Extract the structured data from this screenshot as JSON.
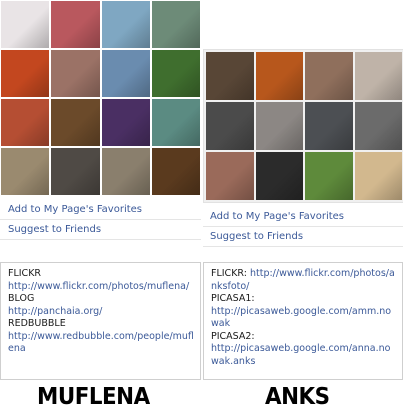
{
  "left": {
    "thumbnails": [
      {
        "name": "cake-photo",
        "color": "#e9e4e6"
      },
      {
        "name": "girl-pink-dress-photo",
        "color": "#b9585e"
      },
      {
        "name": "boy-striped-shirt-photo",
        "color": "#7fa7c2"
      },
      {
        "name": "dragonfly-photo",
        "color": "#6d8b78"
      },
      {
        "name": "red-girl-portrait-photo",
        "color": "#c3471f"
      },
      {
        "name": "woman-face-photo",
        "color": "#9b7266"
      },
      {
        "name": "car-sunset-photo",
        "color": "#6a8caf"
      },
      {
        "name": "tulip-photo",
        "color": "#3f6e2e"
      },
      {
        "name": "boy-portrait-photo",
        "color": "#b54e33"
      },
      {
        "name": "cardboard-robot-photo",
        "color": "#6b4a2a"
      },
      {
        "name": "guitarist-photo",
        "color": "#4a2f63"
      },
      {
        "name": "crowd-park-photo",
        "color": "#5b8b82"
      },
      {
        "name": "girl-lying-photo",
        "color": "#9a8a6f"
      },
      {
        "name": "cat-sleeping-photo",
        "color": "#4f4a45"
      },
      {
        "name": "mountain-road-photo",
        "color": "#8a7f6d"
      },
      {
        "name": "cupcakes-photo",
        "color": "#5a3a1e"
      }
    ],
    "favorites_label": "Add to My Page's Favorites",
    "suggest_label": "Suggest to Friends",
    "info": [
      {
        "label": "FLICKR",
        "link": "http://www.flickr.com/photos/muflena/"
      },
      {
        "label": "BLOG",
        "link": "http://panchaia.org/"
      },
      {
        "label": "REDBUBBLE",
        "link": "http://www.redbubble.com/people/muflena"
      }
    ],
    "caption": "MUFLENA"
  },
  "right": {
    "thumbnails": [
      {
        "name": "city-skyline-photo",
        "color": "#584636"
      },
      {
        "name": "colorful-abstract-photo",
        "color": "#b7571c"
      },
      {
        "name": "woman-portrait-photo",
        "color": "#8f6f5c"
      },
      {
        "name": "girl-smiling-photo",
        "color": "#bfb3a8"
      },
      {
        "name": "black-white-street-photo",
        "color": "#4b4b4b"
      },
      {
        "name": "tabby-cat-photo",
        "color": "#8c8784"
      },
      {
        "name": "man-portrait-photo",
        "color": "#4c4f53"
      },
      {
        "name": "couple-photo",
        "color": "#6b6b6b"
      },
      {
        "name": "girl-hat-photo",
        "color": "#9a6a5a"
      },
      {
        "name": "vintage-camera-photo",
        "color": "#2b2b2b"
      },
      {
        "name": "green-park-photo",
        "color": "#5e8a3b"
      },
      {
        "name": "food-plate-photo",
        "color": "#d2b88e"
      }
    ],
    "favorites_label": "Add to My Page's Favorites",
    "suggest_label": "Suggest to Friends",
    "info": [
      {
        "label": "FLICKR:",
        "link": "http://www.flickr.com/photos/anksfoto/"
      },
      {
        "label": "PICASA1:",
        "link": "http://picasaweb.google.com/amm.nowak"
      },
      {
        "label": "PICASA2:",
        "link": "http://picasaweb.google.com/anna.nowak.anks"
      }
    ],
    "caption": "ANKS"
  }
}
